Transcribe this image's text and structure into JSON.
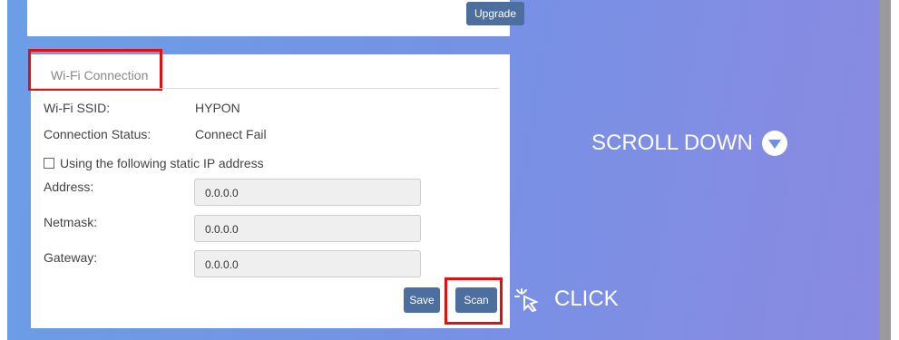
{
  "upgrade_label": "Upgrade",
  "wifi": {
    "title": "Wi-Fi Connection",
    "ssid_label": "Wi-Fi SSID:",
    "ssid_value": "HYPON",
    "status_label": "Connection Status:",
    "status_value": "Connect Fail",
    "static_ip_label": "Using the following static IP address",
    "address_label": "Address:",
    "address_value": "0.0.0.0",
    "netmask_label": "Netmask:",
    "netmask_value": "0.0.0.0",
    "gateway_label": "Gateway:",
    "gateway_value": "0.0.0.0",
    "save_label": "Save",
    "scan_label": "Scan"
  },
  "overlay": {
    "scroll_text": "SCROLL DOWN",
    "click_text": "CLICK"
  },
  "colors": {
    "button": "#4d6f9f",
    "highlight": "#e01010",
    "gradient_start": "#6b9ee6",
    "gradient_end": "#8a8ae2"
  }
}
